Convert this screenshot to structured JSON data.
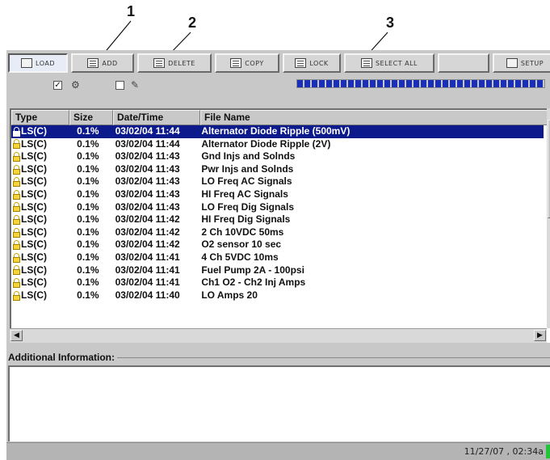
{
  "callouts": [
    "1",
    "2",
    "3"
  ],
  "toolbar": {
    "buttons": [
      {
        "label": "LOAD",
        "icon": "folder-open-icon"
      },
      {
        "label": "ADD",
        "icon": "add-file-icon"
      },
      {
        "label": "DELETE",
        "icon": "delete-file-icon"
      },
      {
        "label": "COPY",
        "icon": "copy-icon"
      },
      {
        "label": "LOCK",
        "icon": "lock-icon"
      },
      {
        "label": "SELECT ALL",
        "icon": "select-all-icon"
      },
      {
        "label": "",
        "icon": ""
      },
      {
        "label": "SETUP",
        "icon": "setup-icon"
      }
    ]
  },
  "controls": {
    "checkbox1_checked": "✓",
    "checkbox2_checked": "",
    "progress_fraction": 1.0
  },
  "table": {
    "columns": [
      "Type",
      "Size",
      "Date/Time",
      "File Name"
    ],
    "rows": [
      {
        "type": "LS(C)",
        "size": "0.1%",
        "date": "03/02/04 11:44",
        "name": "Alternator Diode Ripple (500mV)",
        "selected": true
      },
      {
        "type": "LS(C)",
        "size": "0.1%",
        "date": "03/02/04 11:44",
        "name": "Alternator Diode Ripple (2V)"
      },
      {
        "type": "LS(C)",
        "size": "0.1%",
        "date": "03/02/04 11:43",
        "name": "Gnd Injs and Solnds"
      },
      {
        "type": "LS(C)",
        "size": "0.1%",
        "date": "03/02/04 11:43",
        "name": "Pwr Injs and Solnds"
      },
      {
        "type": "LS(C)",
        "size": "0.1%",
        "date": "03/02/04 11:43",
        "name": "LO Freq AC Signals"
      },
      {
        "type": "LS(C)",
        "size": "0.1%",
        "date": "03/02/04 11:43",
        "name": "HI Freq AC Signals"
      },
      {
        "type": "LS(C)",
        "size": "0.1%",
        "date": "03/02/04 11:43",
        "name": "LO Freq Dig Signals"
      },
      {
        "type": "LS(C)",
        "size": "0.1%",
        "date": "03/02/04 11:42",
        "name": "HI Freq Dig Signals"
      },
      {
        "type": "LS(C)",
        "size": "0.1%",
        "date": "03/02/04 11:42",
        "name": "2 Ch 10VDC 50ms"
      },
      {
        "type": "LS(C)",
        "size": "0.1%",
        "date": "03/02/04 11:42",
        "name": "O2 sensor 10 sec"
      },
      {
        "type": "LS(C)",
        "size": "0.1%",
        "date": "03/02/04 11:41",
        "name": "4 Ch 5VDC 10ms"
      },
      {
        "type": "LS(C)",
        "size": "0.1%",
        "date": "03/02/04 11:41",
        "name": "Fuel Pump 2A - 100psi"
      },
      {
        "type": "LS(C)",
        "size": "0.1%",
        "date": "03/02/04 11:41",
        "name": "Ch1 O2 - Ch2 Inj Amps"
      },
      {
        "type": "LS(C)",
        "size": "0.1%",
        "date": "03/02/04 11:40",
        "name": "LO Amps 20"
      }
    ]
  },
  "info": {
    "label": "Additional Information:"
  },
  "status": {
    "time": "11/27/07 , 02:34a"
  },
  "colors": {
    "selection": "#0d1a8c",
    "progress": "#1a2fb8",
    "status_led": "#23c43b"
  }
}
